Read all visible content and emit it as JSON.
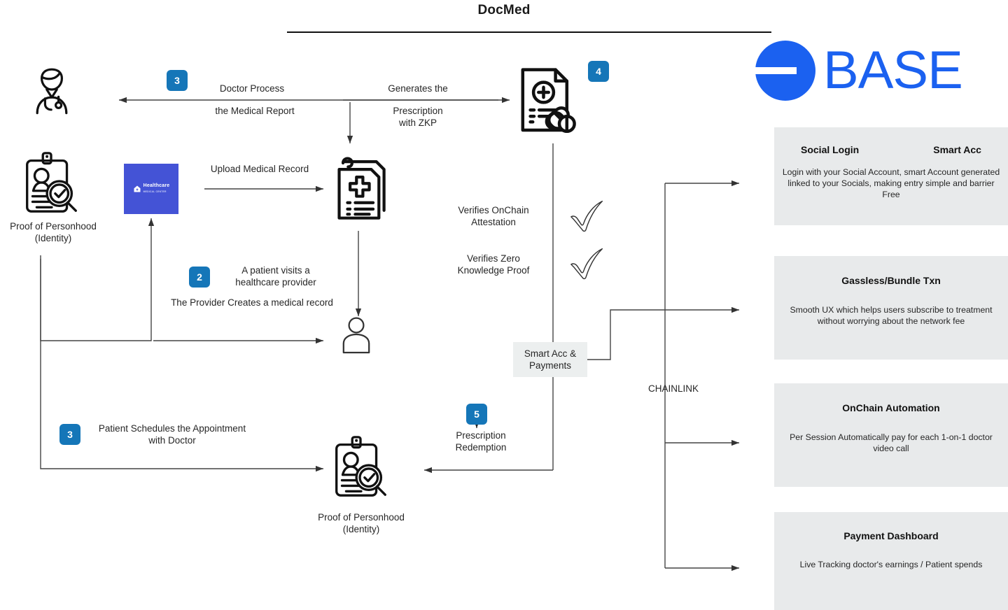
{
  "header": {
    "title": "DocMed"
  },
  "flow": {
    "doctor_icon": "doctor-icon",
    "identity_top": {
      "label": "Proof of Personhood\n(Identity)"
    },
    "identity_bottom": {
      "label": "Proof of Personhood\n(Identity)"
    },
    "healthcare_tile": {
      "name": "Healthcare",
      "subtitle": "MEDICAL CENTER"
    },
    "edges": {
      "doctor_process": "Doctor Process",
      "doctor_process_2": "the Medical Report",
      "generates": "Generates the",
      "generates_2": "Prescription\nwith ZKP",
      "upload": "Upload Medical Record",
      "patient_visits": "A patient visits a\nhealthcare provider",
      "provider_creates": "The Provider Creates a medical record",
      "schedules": "Patient Schedules the Appointment\nwith Doctor",
      "verify_attestation": "Verifies OnChain\nAttestation",
      "verify_zkp": "Verifies Zero\nKnowledge Proof",
      "redemption": "Prescription\nRedemption",
      "chainlink": "CHAINLINK"
    },
    "smart_acc": {
      "label": "Smart Acc &\nPayments"
    },
    "steps": {
      "s3_doctor": "3",
      "s4_prescription": "4",
      "s2_patient": "2",
      "s3_schedule": "3",
      "s5_redemption": "5"
    }
  },
  "brand": {
    "base_word": "BASE"
  },
  "panels": [
    {
      "title_left": "Social Login",
      "title_right": "Smart Acc",
      "body": "Login with your Social Account, smart Account generated linked to your Socials, making entry simple and barrier Free"
    },
    {
      "title": "Gassless/Bundle Txn",
      "body": "Smooth UX which helps users subscribe to treatment without worrying about the network fee"
    },
    {
      "title": "OnChain Automation",
      "body": "Per Session Automatically pay for each 1-on-1 doctor video call"
    },
    {
      "title": "Payment Dashboard",
      "body": "Live Tracking doctor's earnings / Patient spends"
    }
  ],
  "colors": {
    "step_badge": "#1576B8",
    "base_blue": "#1B61F0",
    "healthcare_tile": "#4453D6",
    "panel_bg": "#E8EAEB",
    "smart_acc_bg": "#ECEFEF"
  }
}
